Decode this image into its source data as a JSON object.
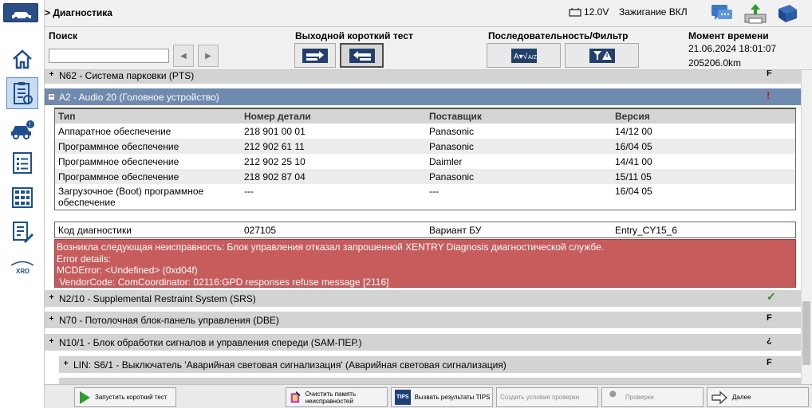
{
  "header": {
    "breadcrumb": "> Диагностика",
    "battery": "12.0V",
    "ignition": "Зажигание ВКЛ"
  },
  "toolbar": {
    "search_label": "Поиск",
    "search_value": "",
    "short_test_label": "Выходной короткий тест",
    "sequence_label": "Последовательность/Фильтр",
    "moment_label": "Момент времени",
    "date": "21.06.2024 18:01:07",
    "mileage": "205206.0km"
  },
  "ecus": [
    {
      "title": "N62 - Система парковки (PTS)",
      "status": "F"
    },
    {
      "title": "A2 - Audio 20 (Головное устройство)",
      "status": "!"
    },
    {
      "title": "N2/10 - Supplemental Restraint System (SRS)",
      "status": "✓"
    },
    {
      "title": "N70 - Потолочная блок-панель управления (DBE)",
      "status": "F"
    },
    {
      "title": "N10/1 - Блок обработки сигналов и управления спереди (SAM-ПЕР.)",
      "status": "¿"
    },
    {
      "title": "LIN: S6/1 - Выключатель 'Аварийная световая сигнализация' (Аварийная световая сигнализация)",
      "status": "F"
    }
  ],
  "version_table": {
    "headers": [
      "Тип",
      "Номер детали",
      "Поставщик",
      "Версия"
    ],
    "rows": [
      [
        "Аппаратное обеспечение",
        "218 901 00 01",
        "Panasonic",
        "14/12 00"
      ],
      [
        "Программное обеспечение",
        "212 902 61 11",
        "Panasonic",
        "16/04 05"
      ],
      [
        "Программное обеспечение",
        "212 902 25 10",
        "Daimler",
        "14/41 00"
      ],
      [
        "Программное обеспечение",
        "218 902 87 04",
        "Panasonic",
        "15/11 05"
      ],
      [
        "Загрузочное (Boot) программное обеспечение",
        "---",
        "---",
        "16/04 05"
      ]
    ]
  },
  "diag_table": {
    "cells": [
      "Код диагностики",
      "027105",
      "Вариант БУ",
      "Entry_CY15_6"
    ]
  },
  "error": {
    "line1": "Возникла следующая неисправность: Блок управления отказал запрошенной XENTRY Diagnosis диагностической службе.",
    "line2": "Error details:",
    "line3": "MCDError: <Undefined> (0xd04f)",
    "line4": " VendorCode: ComCoordinator: 02116:GPD responses refuse message [2116]"
  },
  "bottom": {
    "start_short_test": "Запустить короткий тест",
    "clear_fault_memory": "Очистить память неисправностей",
    "tips_badge": "TIPS",
    "tips_results": "Вызвать результаты TIPS",
    "create_conditions": "Создать условия проверки",
    "checks": "Проверки",
    "next": "Далее"
  },
  "colors": {
    "selected_row": "#6f8aaf",
    "error_bg": "#c75c5c",
    "ok_green": "#2e8b2e",
    "warn_red": "#d01010"
  }
}
